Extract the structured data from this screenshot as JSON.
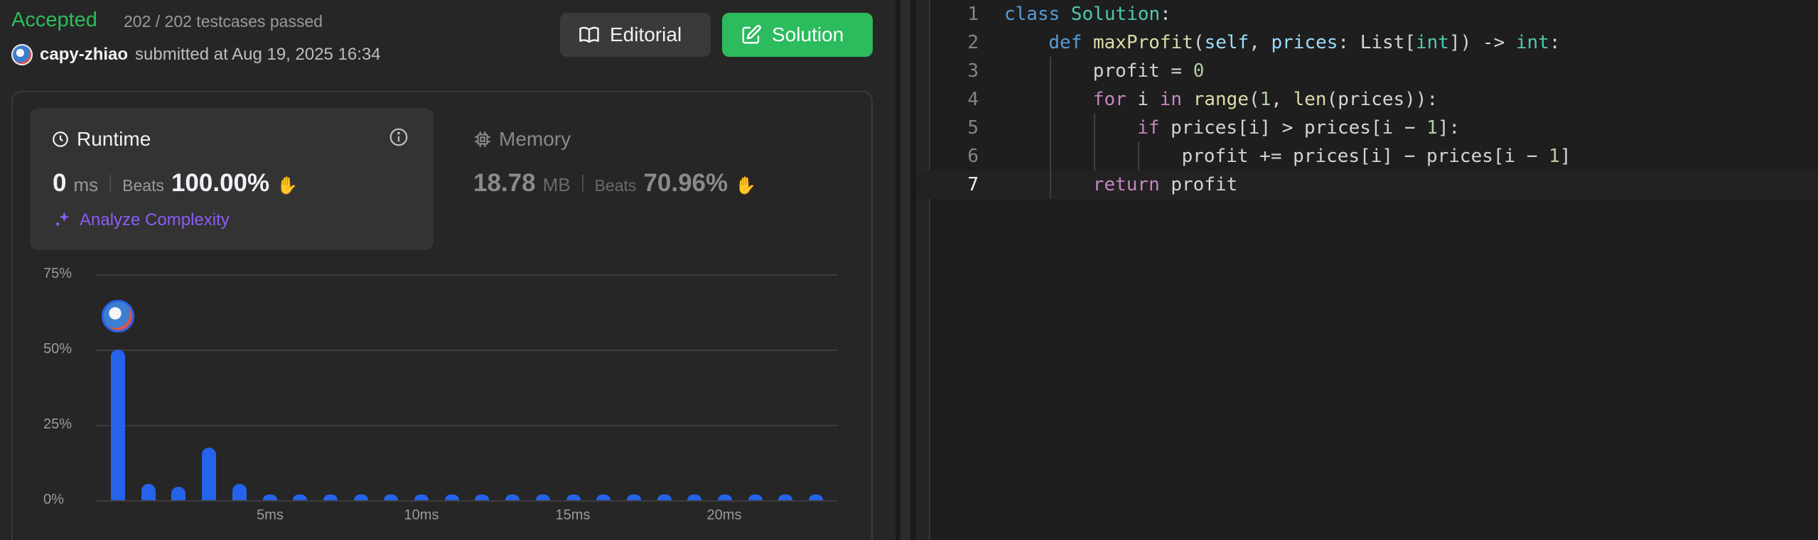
{
  "result": {
    "status": "Accepted",
    "testcases": "202 / 202 testcases passed",
    "username": "capy-zhiao",
    "submitted_text": "submitted at Aug 19, 2025 16:34"
  },
  "buttons": {
    "editorial": "Editorial",
    "solution": "Solution"
  },
  "runtime": {
    "title": "Runtime",
    "value": "0",
    "unit": "ms",
    "beats_label": "Beats",
    "beats_value": "100.00%",
    "analyze": "Analyze Complexity"
  },
  "memory": {
    "title": "Memory",
    "value": "18.78",
    "unit": "MB",
    "beats_label": "Beats",
    "beats_value": "70.96%"
  },
  "colors": {
    "accepted": "#2cbb5d",
    "bar": "#2563eb",
    "analyze": "#8b5cf6"
  },
  "chart_data": {
    "type": "bar",
    "y_ticks": [
      "75%",
      "50%",
      "25%",
      "0%"
    ],
    "x_ticks": [
      "5ms",
      "10ms",
      "15ms",
      "20ms"
    ],
    "ylim": [
      0,
      75
    ],
    "values": [
      50,
      5.5,
      4.5,
      17.5,
      5.5,
      2,
      2,
      2,
      2,
      2,
      2,
      2,
      2,
      2,
      2,
      2,
      2,
      2,
      2,
      2,
      2,
      2,
      2,
      2
    ],
    "grid": true
  },
  "editor": {
    "current_line": 7,
    "lines": [
      {
        "n": "1",
        "indent": 0,
        "tokens": [
          [
            "cls-kw",
            "class "
          ],
          [
            "cls",
            "Solution"
          ],
          [
            "p",
            ":"
          ]
        ]
      },
      {
        "n": "2",
        "indent": 1,
        "tokens": [
          [
            "kwb",
            "def "
          ],
          [
            "fn",
            "maxProfit"
          ],
          [
            "p",
            "("
          ],
          [
            "param",
            "self"
          ],
          [
            "p",
            ", "
          ],
          [
            "param",
            "prices"
          ],
          [
            "p",
            ": List["
          ],
          [
            "cls",
            "int"
          ],
          [
            "p",
            "]) -> "
          ],
          [
            "cls",
            "int"
          ],
          [
            "p",
            ":"
          ]
        ]
      },
      {
        "n": "3",
        "indent": 2,
        "tokens": [
          [
            "p",
            "profit = "
          ],
          [
            "num",
            "0"
          ]
        ]
      },
      {
        "n": "4",
        "indent": 2,
        "tokens": [
          [
            "kw",
            "for "
          ],
          [
            "p",
            "i "
          ],
          [
            "kw",
            "in "
          ],
          [
            "fn",
            "range"
          ],
          [
            "p",
            "("
          ],
          [
            "num",
            "1"
          ],
          [
            "p",
            ", "
          ],
          [
            "fn",
            "len"
          ],
          [
            "p",
            "(prices)):"
          ]
        ]
      },
      {
        "n": "5",
        "indent": 3,
        "tokens": [
          [
            "kw",
            "if "
          ],
          [
            "p",
            "prices[i] > prices[i − "
          ],
          [
            "num",
            "1"
          ],
          [
            "p",
            "]:"
          ]
        ]
      },
      {
        "n": "6",
        "indent": 4,
        "tokens": [
          [
            "p",
            "profit += prices[i] − prices[i − "
          ],
          [
            "num",
            "1"
          ],
          [
            "p",
            "]"
          ]
        ]
      },
      {
        "n": "7",
        "indent": 2,
        "tokens": [
          [
            "kw",
            "return "
          ],
          [
            "p",
            "profit"
          ]
        ]
      }
    ]
  }
}
